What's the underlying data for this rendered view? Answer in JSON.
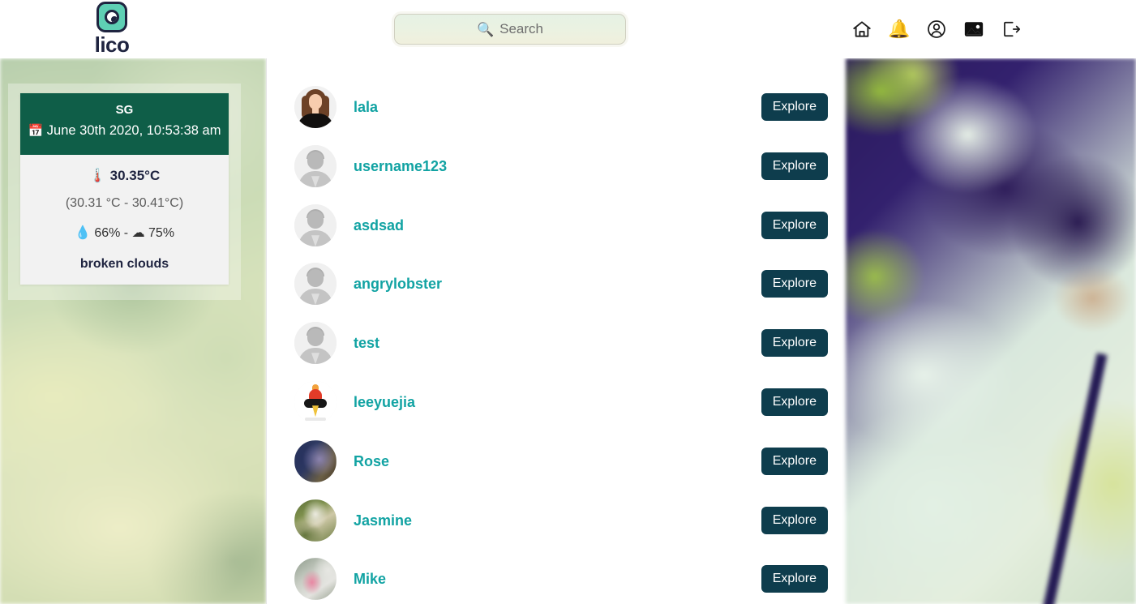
{
  "brand": {
    "name": "lico",
    "logo_icon": "camera-icon"
  },
  "search": {
    "placeholder": "Search",
    "icon": "magnifying-glass-icon",
    "value": ""
  },
  "nav_icons": [
    {
      "name": "home-icon",
      "label": "Home"
    },
    {
      "name": "bell-icon",
      "label": "Notifications",
      "glyph": "🔔"
    },
    {
      "name": "user-icon",
      "label": "Profile"
    },
    {
      "name": "image-icon",
      "label": "Photos"
    },
    {
      "name": "logout-icon",
      "label": "Log out"
    }
  ],
  "weather": {
    "location": "SG",
    "calendar_icon": "📅",
    "datetime": "June 30th 2020, 10:53:38 am",
    "thermometer_icon": "🌡️",
    "temperature": "30.35°C",
    "temperature_range": "(30.31 °C - 30.41°C)",
    "humidity_icon": "💧",
    "humidity": "66%",
    "separator": "-",
    "clouds_icon": "☁",
    "clouds": "75%",
    "description": "broken clouds",
    "header_color": "#0f5e48",
    "body_color": "#f2f2f2"
  },
  "users": [
    {
      "username": "lala",
      "avatar": "woman-illustration-avatar",
      "button": "Explore"
    },
    {
      "username": "username123",
      "avatar": "default-gray-avatar",
      "button": "Explore"
    },
    {
      "username": "asdsad",
      "avatar": "default-gray-avatar",
      "button": "Explore"
    },
    {
      "username": "angrylobster",
      "avatar": "default-gray-avatar",
      "button": "Explore"
    },
    {
      "username": "test",
      "avatar": "default-gray-avatar",
      "button": "Explore"
    },
    {
      "username": "leeyuejia",
      "avatar": "bird-photo-avatar",
      "button": "Explore"
    },
    {
      "username": "Rose",
      "avatar": "photo-avatar-dark-blue",
      "button": "Explore"
    },
    {
      "username": "Jasmine",
      "avatar": "photo-avatar-outdoor",
      "button": "Explore"
    },
    {
      "username": "Mike",
      "avatar": "photo-avatar-pink",
      "button": "Explore"
    }
  ],
  "colors": {
    "accent_teal": "#12a3a3",
    "button_dark": "#0e3d4d",
    "weather_green": "#0f5e48",
    "brand_navy": "#1f2440",
    "logo_teal": "#5ed0b4"
  }
}
